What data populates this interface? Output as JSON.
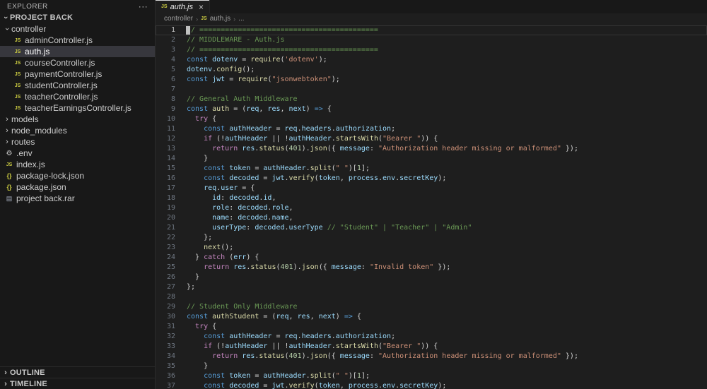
{
  "colors": {
    "editor-bg": "#1e1e1e",
    "sidebar-bg": "#181818",
    "tabbar-bg": "#181818",
    "selection-bg": "#37373d",
    "comment": "#6a9955",
    "keyword": "#569cd6",
    "control": "#c586c0",
    "string": "#ce9178",
    "func": "#dcdcaa",
    "variable": "#9cdcfe",
    "number": "#b5cea8",
    "punct": "#d4d4d4",
    "js-icon": "#cbcb41",
    "line-number": "#6e7681"
  },
  "sidebar": {
    "header": "EXPLORER",
    "header_actions": "···",
    "project": "PROJECT BACK",
    "outline": "OUTLINE",
    "timeline": "TIMELINE",
    "tree": [
      {
        "kind": "folder",
        "icon": "chevron",
        "label": "controller",
        "level": 0,
        "expanded": true
      },
      {
        "kind": "file",
        "icon": "js",
        "label": "adminController.js",
        "level": 1
      },
      {
        "kind": "file",
        "icon": "js",
        "label": "auth.js",
        "level": 1,
        "selected": true
      },
      {
        "kind": "file",
        "icon": "js",
        "label": "courseController.js",
        "level": 1
      },
      {
        "kind": "file",
        "icon": "js",
        "label": "paymentController.js",
        "level": 1
      },
      {
        "kind": "file",
        "icon": "js",
        "label": "studentController.js",
        "level": 1
      },
      {
        "kind": "file",
        "icon": "js",
        "label": "teacherController.js",
        "level": 1
      },
      {
        "kind": "file",
        "icon": "js",
        "label": "teacherEarningsController.js",
        "level": 1
      },
      {
        "kind": "folder",
        "icon": "chevron",
        "label": "models",
        "level": 0,
        "expanded": false
      },
      {
        "kind": "folder",
        "icon": "chevron",
        "label": "node_modules",
        "level": 0,
        "expanded": false
      },
      {
        "kind": "folder",
        "icon": "chevron",
        "label": "routes",
        "level": 0,
        "expanded": false
      },
      {
        "kind": "file",
        "icon": "gear",
        "label": ".env",
        "level": 0
      },
      {
        "kind": "file",
        "icon": "js",
        "label": "index.js",
        "level": 0
      },
      {
        "kind": "file",
        "icon": "braces",
        "label": "package-lock.json",
        "level": 0
      },
      {
        "kind": "file",
        "icon": "braces",
        "label": "package.json",
        "level": 0
      },
      {
        "kind": "file",
        "icon": "archive",
        "label": "project back.rar",
        "level": 0
      }
    ]
  },
  "editor": {
    "tab": "auth.js",
    "tab_close": "×",
    "breadcrumb": {
      "folder": "controller",
      "file": "auth.js",
      "symbol": "..."
    },
    "cursor_line": 1,
    "code": [
      [
        [
          "c",
          "// =========================================="
        ]
      ],
      [
        [
          "c",
          "// MIDDLEWARE - Auth.js"
        ]
      ],
      [
        [
          "c",
          "// =========================================="
        ]
      ],
      [
        [
          "k",
          "const"
        ],
        [
          "p",
          " "
        ],
        [
          "v",
          "dotenv"
        ],
        [
          "p",
          " = "
        ],
        [
          "y",
          "require"
        ],
        [
          "p",
          "("
        ],
        [
          "s",
          "'dotenv'"
        ],
        [
          "p",
          ");"
        ]
      ],
      [
        [
          "v",
          "dotenv"
        ],
        [
          "p",
          "."
        ],
        [
          "y",
          "config"
        ],
        [
          "p",
          "();"
        ]
      ],
      [
        [
          "k",
          "const"
        ],
        [
          "p",
          " "
        ],
        [
          "v",
          "jwt"
        ],
        [
          "p",
          " = "
        ],
        [
          "y",
          "require"
        ],
        [
          "p",
          "("
        ],
        [
          "s",
          "\"jsonwebtoken\""
        ],
        [
          "p",
          ");"
        ]
      ],
      [],
      [
        [
          "c",
          "// General Auth Middleware"
        ]
      ],
      [
        [
          "k",
          "const"
        ],
        [
          "p",
          " "
        ],
        [
          "y",
          "auth"
        ],
        [
          "p",
          " = ("
        ],
        [
          "v",
          "req"
        ],
        [
          "p",
          ", "
        ],
        [
          "v",
          "res"
        ],
        [
          "p",
          ", "
        ],
        [
          "v",
          "next"
        ],
        [
          "p",
          ") "
        ],
        [
          "k",
          "=>"
        ],
        [
          "p",
          " {"
        ]
      ],
      [
        [
          "p",
          "  "
        ],
        [
          "f",
          "try"
        ],
        [
          "p",
          " {"
        ]
      ],
      [
        [
          "p",
          "    "
        ],
        [
          "k",
          "const"
        ],
        [
          "p",
          " "
        ],
        [
          "v",
          "authHeader"
        ],
        [
          "p",
          " = "
        ],
        [
          "v",
          "req"
        ],
        [
          "p",
          "."
        ],
        [
          "v",
          "headers"
        ],
        [
          "p",
          "."
        ],
        [
          "v",
          "authorization"
        ],
        [
          "p",
          ";"
        ]
      ],
      [
        [
          "p",
          "    "
        ],
        [
          "f",
          "if"
        ],
        [
          "p",
          " (!"
        ],
        [
          "v",
          "authHeader"
        ],
        [
          "p",
          " || !"
        ],
        [
          "v",
          "authHeader"
        ],
        [
          "p",
          "."
        ],
        [
          "y",
          "startsWith"
        ],
        [
          "p",
          "("
        ],
        [
          "s",
          "\"Bearer \""
        ],
        [
          "p",
          ")) {"
        ]
      ],
      [
        [
          "p",
          "      "
        ],
        [
          "f",
          "return"
        ],
        [
          "p",
          " "
        ],
        [
          "v",
          "res"
        ],
        [
          "p",
          "."
        ],
        [
          "y",
          "status"
        ],
        [
          "p",
          "("
        ],
        [
          "n",
          "401"
        ],
        [
          "p",
          ")."
        ],
        [
          "y",
          "json"
        ],
        [
          "p",
          "({ "
        ],
        [
          "v",
          "message"
        ],
        [
          "p",
          ": "
        ],
        [
          "s",
          "\"Authorization header missing or malformed\""
        ],
        [
          "p",
          " });"
        ]
      ],
      [
        [
          "p",
          "    }"
        ]
      ],
      [
        [
          "p",
          "    "
        ],
        [
          "k",
          "const"
        ],
        [
          "p",
          " "
        ],
        [
          "v",
          "token"
        ],
        [
          "p",
          " = "
        ],
        [
          "v",
          "authHeader"
        ],
        [
          "p",
          "."
        ],
        [
          "y",
          "split"
        ],
        [
          "p",
          "("
        ],
        [
          "s",
          "\" \""
        ],
        [
          "p",
          ")["
        ],
        [
          "n",
          "1"
        ],
        [
          "p",
          "];"
        ]
      ],
      [
        [
          "p",
          "    "
        ],
        [
          "k",
          "const"
        ],
        [
          "p",
          " "
        ],
        [
          "v",
          "decoded"
        ],
        [
          "p",
          " = "
        ],
        [
          "v",
          "jwt"
        ],
        [
          "p",
          "."
        ],
        [
          "y",
          "verify"
        ],
        [
          "p",
          "("
        ],
        [
          "v",
          "token"
        ],
        [
          "p",
          ", "
        ],
        [
          "v",
          "process"
        ],
        [
          "p",
          "."
        ],
        [
          "v",
          "env"
        ],
        [
          "p",
          "."
        ],
        [
          "v",
          "secretKey"
        ],
        [
          "p",
          ");"
        ]
      ],
      [
        [
          "p",
          "    "
        ],
        [
          "v",
          "req"
        ],
        [
          "p",
          "."
        ],
        [
          "v",
          "user"
        ],
        [
          "p",
          " = {"
        ]
      ],
      [
        [
          "p",
          "      "
        ],
        [
          "v",
          "id"
        ],
        [
          "p",
          ": "
        ],
        [
          "v",
          "decoded"
        ],
        [
          "p",
          "."
        ],
        [
          "v",
          "id"
        ],
        [
          "p",
          ","
        ]
      ],
      [
        [
          "p",
          "      "
        ],
        [
          "v",
          "role"
        ],
        [
          "p",
          ": "
        ],
        [
          "v",
          "decoded"
        ],
        [
          "p",
          "."
        ],
        [
          "v",
          "role"
        ],
        [
          "p",
          ","
        ]
      ],
      [
        [
          "p",
          "      "
        ],
        [
          "v",
          "name"
        ],
        [
          "p",
          ": "
        ],
        [
          "v",
          "decoded"
        ],
        [
          "p",
          "."
        ],
        [
          "v",
          "name"
        ],
        [
          "p",
          ","
        ]
      ],
      [
        [
          "p",
          "      "
        ],
        [
          "v",
          "userType"
        ],
        [
          "p",
          ": "
        ],
        [
          "v",
          "decoded"
        ],
        [
          "p",
          "."
        ],
        [
          "v",
          "userType"
        ],
        [
          "p",
          " "
        ],
        [
          "c",
          "// \"Student\" | \"Teacher\" | \"Admin\""
        ]
      ],
      [
        [
          "p",
          "    };"
        ]
      ],
      [
        [
          "p",
          "    "
        ],
        [
          "y",
          "next"
        ],
        [
          "p",
          "();"
        ]
      ],
      [
        [
          "p",
          "  } "
        ],
        [
          "f",
          "catch"
        ],
        [
          "p",
          " ("
        ],
        [
          "v",
          "err"
        ],
        [
          "p",
          ") {"
        ]
      ],
      [
        [
          "p",
          "    "
        ],
        [
          "f",
          "return"
        ],
        [
          "p",
          " "
        ],
        [
          "v",
          "res"
        ],
        [
          "p",
          "."
        ],
        [
          "y",
          "status"
        ],
        [
          "p",
          "("
        ],
        [
          "n",
          "401"
        ],
        [
          "p",
          ")."
        ],
        [
          "y",
          "json"
        ],
        [
          "p",
          "({ "
        ],
        [
          "v",
          "message"
        ],
        [
          "p",
          ": "
        ],
        [
          "s",
          "\"Invalid token\""
        ],
        [
          "p",
          " });"
        ]
      ],
      [
        [
          "p",
          "  }"
        ]
      ],
      [
        [
          "p",
          "};"
        ]
      ],
      [],
      [
        [
          "c",
          "// Student Only Middleware"
        ]
      ],
      [
        [
          "k",
          "const"
        ],
        [
          "p",
          " "
        ],
        [
          "y",
          "authStudent"
        ],
        [
          "p",
          " = ("
        ],
        [
          "v",
          "req"
        ],
        [
          "p",
          ", "
        ],
        [
          "v",
          "res"
        ],
        [
          "p",
          ", "
        ],
        [
          "v",
          "next"
        ],
        [
          "p",
          ") "
        ],
        [
          "k",
          "=>"
        ],
        [
          "p",
          " {"
        ]
      ],
      [
        [
          "p",
          "  "
        ],
        [
          "f",
          "try"
        ],
        [
          "p",
          " {"
        ]
      ],
      [
        [
          "p",
          "    "
        ],
        [
          "k",
          "const"
        ],
        [
          "p",
          " "
        ],
        [
          "v",
          "authHeader"
        ],
        [
          "p",
          " = "
        ],
        [
          "v",
          "req"
        ],
        [
          "p",
          "."
        ],
        [
          "v",
          "headers"
        ],
        [
          "p",
          "."
        ],
        [
          "v",
          "authorization"
        ],
        [
          "p",
          ";"
        ]
      ],
      [
        [
          "p",
          "    "
        ],
        [
          "f",
          "if"
        ],
        [
          "p",
          " (!"
        ],
        [
          "v",
          "authHeader"
        ],
        [
          "p",
          " || !"
        ],
        [
          "v",
          "authHeader"
        ],
        [
          "p",
          "."
        ],
        [
          "y",
          "startsWith"
        ],
        [
          "p",
          "("
        ],
        [
          "s",
          "\"Bearer \""
        ],
        [
          "p",
          ")) {"
        ]
      ],
      [
        [
          "p",
          "      "
        ],
        [
          "f",
          "return"
        ],
        [
          "p",
          " "
        ],
        [
          "v",
          "res"
        ],
        [
          "p",
          "."
        ],
        [
          "y",
          "status"
        ],
        [
          "p",
          "("
        ],
        [
          "n",
          "401"
        ],
        [
          "p",
          ")."
        ],
        [
          "y",
          "json"
        ],
        [
          "p",
          "({ "
        ],
        [
          "v",
          "message"
        ],
        [
          "p",
          ": "
        ],
        [
          "s",
          "\"Authorization header missing or malformed\""
        ],
        [
          "p",
          " });"
        ]
      ],
      [
        [
          "p",
          "    }"
        ]
      ],
      [
        [
          "p",
          "    "
        ],
        [
          "k",
          "const"
        ],
        [
          "p",
          " "
        ],
        [
          "v",
          "token"
        ],
        [
          "p",
          " = "
        ],
        [
          "v",
          "authHeader"
        ],
        [
          "p",
          "."
        ],
        [
          "y",
          "split"
        ],
        [
          "p",
          "("
        ],
        [
          "s",
          "\" \""
        ],
        [
          "p",
          ")["
        ],
        [
          "n",
          "1"
        ],
        [
          "p",
          "];"
        ]
      ],
      [
        [
          "p",
          "    "
        ],
        [
          "k",
          "const"
        ],
        [
          "p",
          " "
        ],
        [
          "v",
          "decoded"
        ],
        [
          "p",
          " = "
        ],
        [
          "v",
          "jwt"
        ],
        [
          "p",
          "."
        ],
        [
          "y",
          "verify"
        ],
        [
          "p",
          "("
        ],
        [
          "v",
          "token"
        ],
        [
          "p",
          ", "
        ],
        [
          "v",
          "process"
        ],
        [
          "p",
          "."
        ],
        [
          "v",
          "env"
        ],
        [
          "p",
          "."
        ],
        [
          "v",
          "secretKey"
        ],
        [
          "p",
          ");"
        ]
      ]
    ]
  }
}
